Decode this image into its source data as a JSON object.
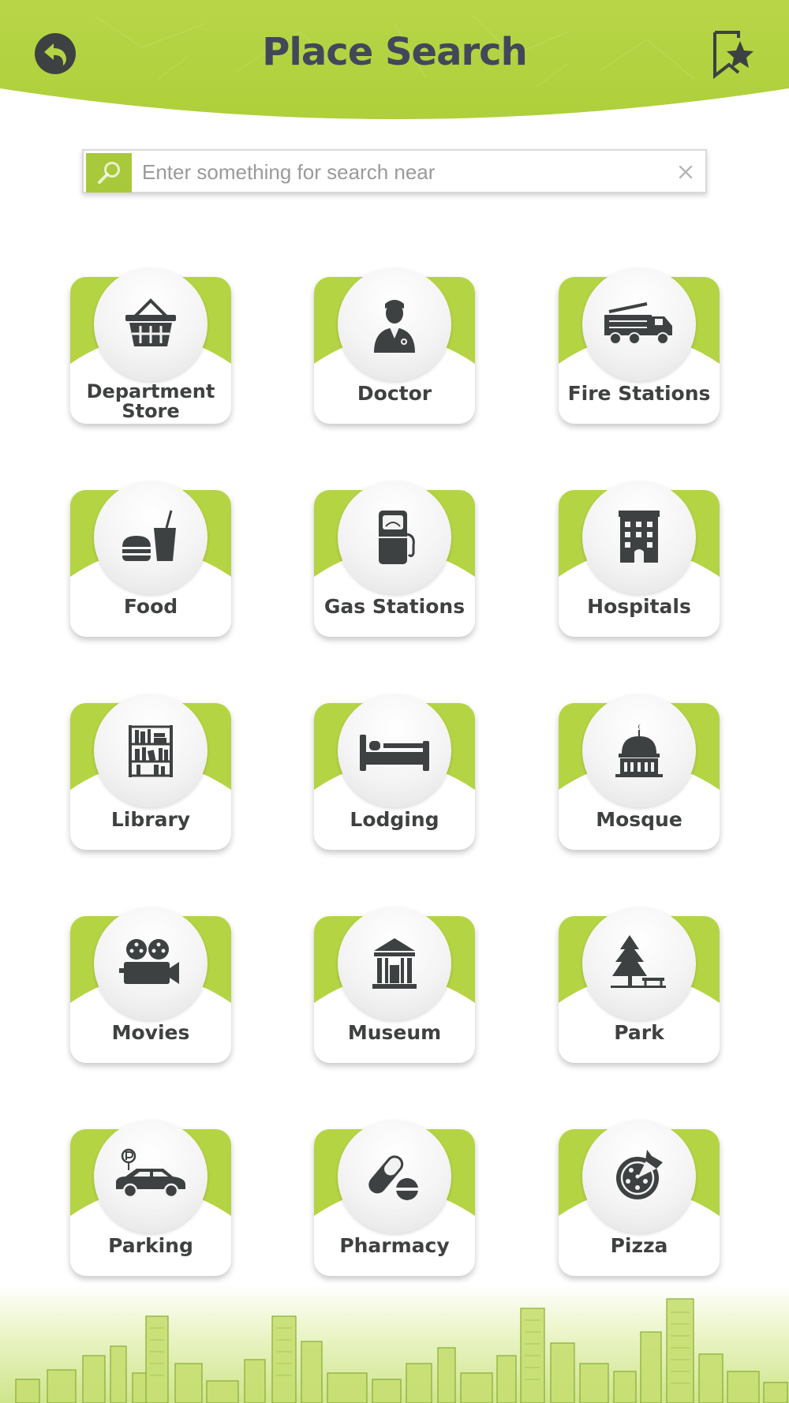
{
  "header": {
    "title": "Place Search",
    "back_icon": "back-arrow-icon",
    "bookmark_icon": "bookmark-star-icon"
  },
  "search": {
    "placeholder": "Enter something for search near",
    "value": "",
    "search_icon": "search-icon",
    "clear_icon": "close-icon"
  },
  "colors": {
    "accent": "#b5d444",
    "accent_dark": "#a8c93c",
    "text": "#3f4141",
    "title": "#43475a"
  },
  "categories": [
    {
      "label": "Department Store",
      "icon": "shopping-basket-icon"
    },
    {
      "label": "Doctor",
      "icon": "doctor-icon"
    },
    {
      "label": "Fire Stations",
      "icon": "fire-truck-icon"
    },
    {
      "label": "Food",
      "icon": "burger-drink-icon"
    },
    {
      "label": "Gas Stations",
      "icon": "fuel-pump-icon"
    },
    {
      "label": "Hospitals",
      "icon": "hospital-building-icon"
    },
    {
      "label": "Library",
      "icon": "bookshelf-icon"
    },
    {
      "label": "Lodging",
      "icon": "bed-icon"
    },
    {
      "label": "Mosque",
      "icon": "mosque-dome-icon"
    },
    {
      "label": "Movies",
      "icon": "movie-camera-icon"
    },
    {
      "label": "Museum",
      "icon": "museum-building-icon"
    },
    {
      "label": "Park",
      "icon": "tree-bench-icon"
    },
    {
      "label": "Parking",
      "icon": "car-parking-icon"
    },
    {
      "label": "Pharmacy",
      "icon": "pills-icon"
    },
    {
      "label": "Pizza",
      "icon": "pizza-icon"
    }
  ]
}
